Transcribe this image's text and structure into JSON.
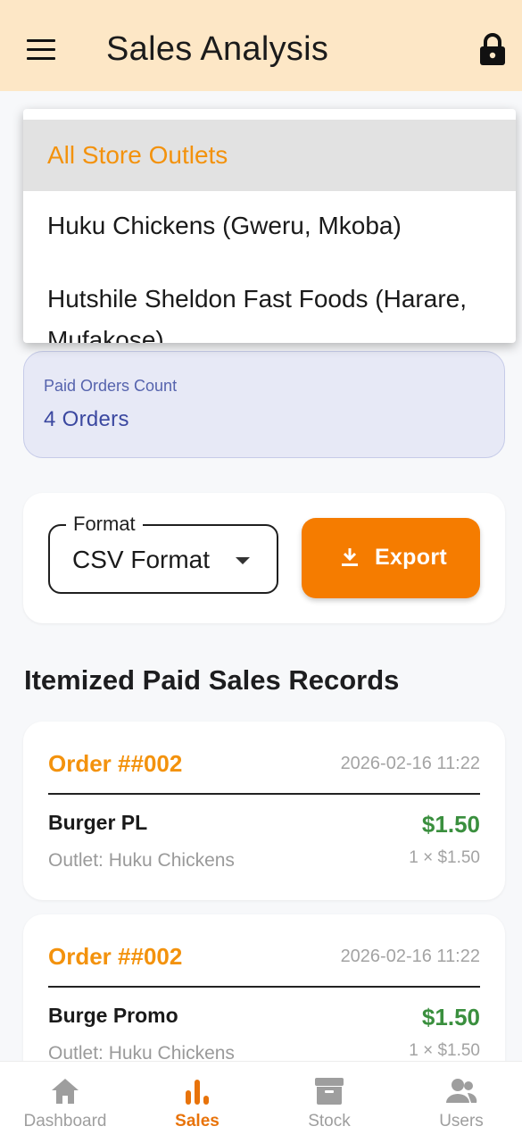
{
  "appbar": {
    "title": "Sales Analysis",
    "menu_icon": "menu-icon",
    "lock_icon": "lock-icon"
  },
  "outlet_dropdown": {
    "items": [
      {
        "label": "All Store Outlets",
        "selected": true
      },
      {
        "label": "Huku Chickens (Gweru, Mkoba)"
      },
      {
        "label": "Hutshile Sheldon Fast Foods (Harare, Mufakose)"
      }
    ]
  },
  "paid_orders": {
    "label": "Paid Orders Count",
    "value": "4 Orders"
  },
  "export": {
    "format_legend": "Format",
    "format_value": "CSV Format",
    "button_label": "Export",
    "button_icon": "download-icon"
  },
  "records": {
    "title": "Itemized Paid Sales Records",
    "orders": [
      {
        "order_id": "Order ##002",
        "date": "2026-02-16 11:22",
        "item": "Burger PL",
        "price": "$1.50",
        "outlet": "Outlet: Huku Chickens",
        "qty": "1 × $1.50"
      },
      {
        "order_id": "Order ##002",
        "date": "2026-02-16 11:22",
        "item": "Burge Promo",
        "price": "$1.50",
        "outlet": "Outlet: Huku Chickens",
        "qty": "1 × $1.50"
      }
    ]
  },
  "bottom_nav": {
    "items": [
      {
        "label": "Dashboard",
        "icon": "home-icon",
        "active": false
      },
      {
        "label": "Sales",
        "icon": "bar-chart-icon",
        "active": true
      },
      {
        "label": "Stock",
        "icon": "archive-icon",
        "active": false
      },
      {
        "label": "Users",
        "icon": "users-icon",
        "active": false
      }
    ]
  },
  "colors": {
    "accent": "#f57c00",
    "appbar_bg": "#fde7c6",
    "price_green": "#3a8f3e",
    "order_orange": "#f3920d"
  }
}
